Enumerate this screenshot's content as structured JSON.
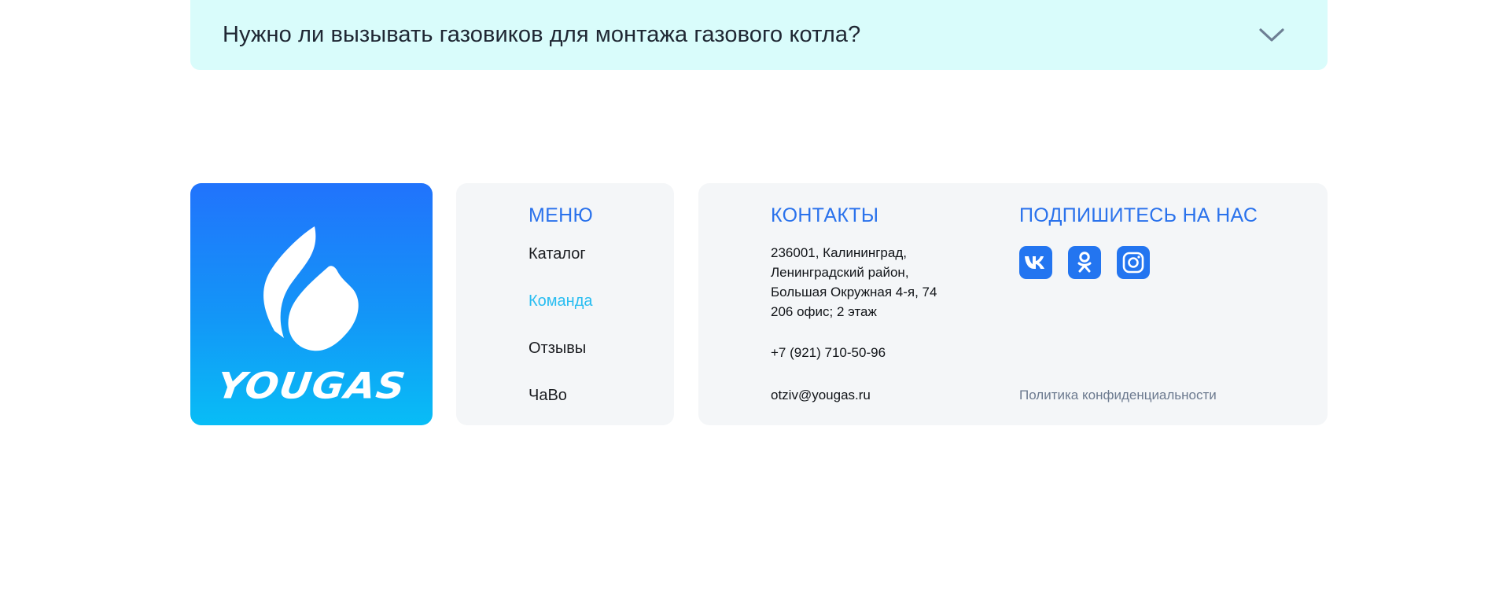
{
  "faq": {
    "question": "Нужно ли вызывать газовиков для монтажа газового котла?",
    "expand_icon": "chevron-down-icon",
    "background": "#d9fcfb"
  },
  "logo": {
    "wordmark": "YOUGAS",
    "icon": "flame-logo-icon",
    "gradient_top": "#2173fc",
    "gradient_bottom": "#08bdf6"
  },
  "menu": {
    "heading": "МЕНЮ",
    "items": [
      {
        "label": "Каталог",
        "active": false
      },
      {
        "label": "Команда",
        "active": true
      },
      {
        "label": "Отзывы",
        "active": false
      },
      {
        "label": "ЧаВо",
        "active": false
      }
    ]
  },
  "contacts": {
    "heading": "КОНТАКТЫ",
    "address_lines": [
      "236001, Калининград,",
      "Ленинградский район,",
      "Большая Окружная 4-я, 74",
      "206 офис; 2 этаж"
    ],
    "phone": "+7 (921) 710-50-96",
    "email": "otziv@yougas.ru"
  },
  "subscribe": {
    "heading": "ПОДПИШИТЕСЬ НА НАС",
    "socials": [
      "vk-icon",
      "odnoklassniki-icon",
      "instagram-icon"
    ],
    "policy": "Политика конфиденциальности"
  },
  "colors": {
    "accent": "#2a72ec",
    "active_link": "#28bdf1",
    "panel_bg": "#f4f6f8",
    "muted": "#6c7a8f"
  }
}
